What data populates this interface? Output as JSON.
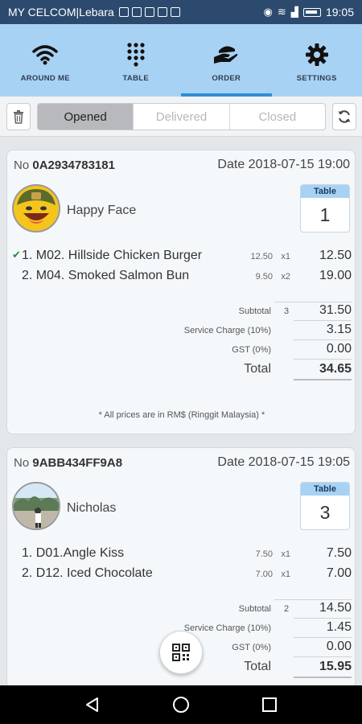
{
  "status_bar": {
    "carrier": "MY CELCOM|Lebara",
    "time": "19:05"
  },
  "nav": {
    "tabs": [
      {
        "label": "AROUND ME",
        "icon": "wifi-icon"
      },
      {
        "label": "TABLE",
        "icon": "keypad-icon"
      },
      {
        "label": "ORDER",
        "icon": "serving-hand-icon"
      },
      {
        "label": "SETTINGS",
        "icon": "gear-icon"
      }
    ],
    "active": "ORDER"
  },
  "filter": {
    "options": [
      "Opened",
      "Delivered",
      "Closed"
    ],
    "selected": "Opened"
  },
  "orders": [
    {
      "no_label": "No",
      "no": "0A2934783181",
      "date_label": "Date",
      "date": "2018-07-15 19:00",
      "customer": "Happy Face",
      "table_label": "Table",
      "table_no": "1",
      "items": [
        {
          "name": "1. M02. Hillside Chicken Burger",
          "unit_price": "12.50",
          "qty": "x1",
          "amount": "12.50",
          "checked": true
        },
        {
          "name": "2. M04. Smoked Salmon Bun",
          "unit_price": "9.50",
          "qty": "x2",
          "amount": "19.00",
          "checked": false
        }
      ],
      "subtotal_label": "Subtotal",
      "item_count": "3",
      "subtotal": "31.50",
      "service_label": "Service Charge (10%)",
      "service": "3.15",
      "gst_label": "GST (0%)",
      "gst": "0.00",
      "total_label": "Total",
      "total": "34.65",
      "note": "* All prices are in RM$ (Ringgit Malaysia) *"
    },
    {
      "no_label": "No",
      "no": "9ABB434FF9A8",
      "date_label": "Date",
      "date": "2018-07-15 19:05",
      "customer": "Nicholas",
      "table_label": "Table",
      "table_no": "3",
      "items": [
        {
          "name": "1. D01.Angle Kiss",
          "unit_price": "7.50",
          "qty": "x1",
          "amount": "7.50",
          "checked": false
        },
        {
          "name": "2. D12. Iced Chocolate",
          "unit_price": "7.00",
          "qty": "x1",
          "amount": "7.00",
          "checked": false
        }
      ],
      "subtotal_label": "Subtotal",
      "item_count": "2",
      "subtotal": "14.50",
      "service_label": "Service Charge (10%)",
      "service": "1.45",
      "gst_label": "GST (0%)",
      "gst": "0.00",
      "total_label": "Total",
      "total": "15.95"
    }
  ],
  "colors": {
    "status_bar": "#2b4a6e",
    "nav_bg": "#a8d2f4",
    "nav_indicator": "#2f8fd8",
    "check": "#2a8a3a"
  }
}
